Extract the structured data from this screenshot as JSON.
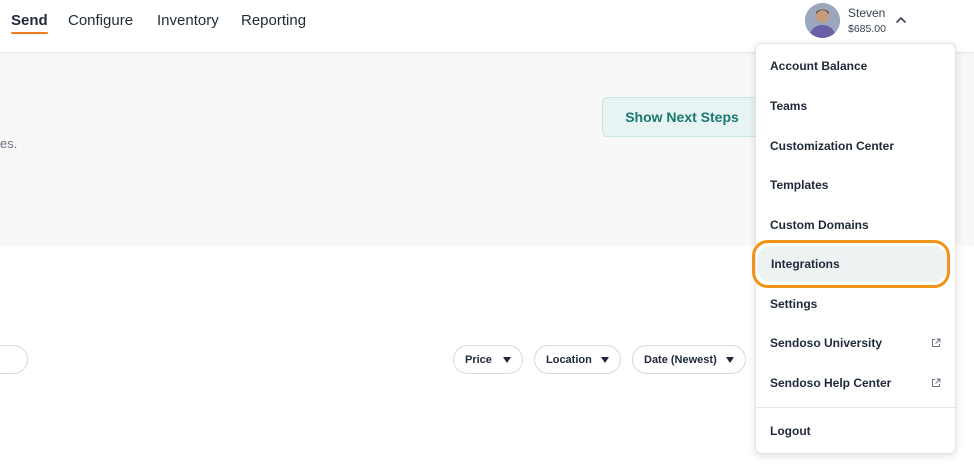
{
  "nav": {
    "items": [
      {
        "label": "Send",
        "active": true
      },
      {
        "label": "Configure",
        "active": false
      },
      {
        "label": "Inventory",
        "active": false
      },
      {
        "label": "Reporting",
        "active": false
      }
    ]
  },
  "user": {
    "name": "Steven",
    "balance": "$685.00"
  },
  "hero": {
    "description_fragment": "es.",
    "next_steps_label": "Show Next Steps"
  },
  "filters": {
    "price": "Price",
    "location": "Location",
    "date": "Date (Newest)"
  },
  "menu": {
    "items": [
      {
        "label": "Account Balance",
        "external": false
      },
      {
        "label": "Teams",
        "external": false
      },
      {
        "label": "Customization Center",
        "external": false
      },
      {
        "label": "Templates",
        "external": false
      },
      {
        "label": "Custom Domains",
        "external": false
      },
      {
        "label": "Integrations",
        "external": false,
        "highlighted": true
      },
      {
        "label": "Settings",
        "external": false
      },
      {
        "label": "Sendoso University",
        "external": true
      },
      {
        "label": "Sendoso Help Center",
        "external": true
      }
    ],
    "logout": "Logout"
  },
  "colors": {
    "accent_orange": "#f07d22",
    "highlight_ring": "#f39219",
    "teal_text": "#17796f",
    "teal_bg": "#e8f3f3"
  }
}
